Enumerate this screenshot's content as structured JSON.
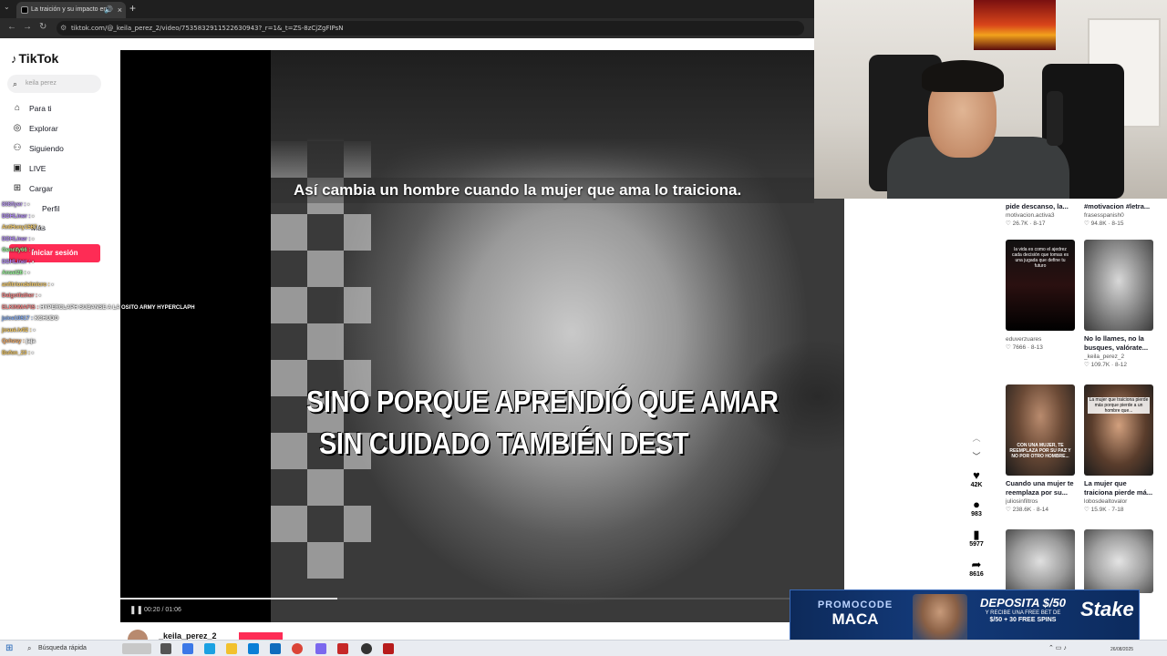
{
  "browser": {
    "tab_title": "La traición y su impacto en",
    "new_tab": "+",
    "url": "tiktok.com/@_keila_perez_2/video/7535832911522630943?_r=1&_t=ZS-8zCjZgFIPsN"
  },
  "sidebar": {
    "logo": "TikTok",
    "search_placeholder": "keila perez",
    "items": [
      {
        "label": "Para ti",
        "icon": "home-icon"
      },
      {
        "label": "Explorar",
        "icon": "compass-icon"
      },
      {
        "label": "Siguiendo",
        "icon": "following-icon"
      },
      {
        "label": "LIVE",
        "icon": "live-icon"
      },
      {
        "label": "Cargar",
        "icon": "upload-icon"
      },
      {
        "label": "Perfil",
        "icon": "profile-icon"
      },
      {
        "label": "Más",
        "icon": "more-icon"
      }
    ],
    "login": "Iniciar sesión"
  },
  "chat": [
    {
      "user": "808flyer",
      "msg": "",
      "color": "#c6a6ff"
    },
    {
      "user": "DDHLiner",
      "msg": "",
      "color": "#b890ff"
    },
    {
      "user": "AntHony1567",
      "msg": "",
      "color": "#ffd36a"
    },
    {
      "user": "DDHLiner",
      "msg": "",
      "color": "#b890ff"
    },
    {
      "user": "Genrify66",
      "msg": "",
      "color": "#9cff9c"
    },
    {
      "user": "DDHLiner",
      "msg": "",
      "color": "#b890ff"
    },
    {
      "user": "Ansel26",
      "msg": "",
      "color": "#9cff9c"
    },
    {
      "user": "anfitriondelmicro",
      "msg": "",
      "color": "#ffd36a"
    },
    {
      "user": "Dalgotfather",
      "msg": "",
      "color": "#ff8a8a"
    },
    {
      "user": "ELKINMAFIS",
      "msg": "HYPERCLAPH SUBANSE A LA OSITO ARMY HYPERCLAPH",
      "color": "#ff8a8a"
    },
    {
      "user": "juice10617",
      "msg": "KCHUDO",
      "color": "#8ab4ff"
    },
    {
      "user": "josué.lv92",
      "msg": "",
      "color": "#ffd36a"
    },
    {
      "user": "Qchzsy",
      "msg": "jaja",
      "color": "#ffb36a"
    },
    {
      "user": "Bufon_23",
      "msg": "",
      "color": "#ffd36a"
    }
  ],
  "video": {
    "subtitle_top": "Así cambia un hombre cuando la mujer que ama lo traiciona.",
    "subtitle_line1": "SINO PORQUE APRENDIÓ QUE AMAR",
    "subtitle_line2": "SIN CUIDADO TAMBIÉN DEST",
    "time": "00:20 / 01:06",
    "progress": 0.3,
    "play_icon": "pause-icon"
  },
  "actions": {
    "likes": "42K",
    "comments": "983",
    "saves": "5977",
    "shares": "8616"
  },
  "recommendations": [
    {
      "title": "pide descanso, la...",
      "user": "motivacion.activa3",
      "views": "26.7K",
      "date": "8-17"
    },
    {
      "title": "#motivacion #letra...",
      "user": "frasesspanish0",
      "views": "94.8K",
      "date": "8-15"
    },
    {
      "title": "",
      "user": "eduverzuares",
      "views": "7666",
      "date": "8-13",
      "thumb_text": "la vida es como el ajedrez cada decisión que tomas es una jugada que define tu futuro"
    },
    {
      "title": "No lo llames, no la busques, valórate...",
      "user": "_keila_perez_2",
      "views": "109.7K",
      "date": "8-12"
    },
    {
      "title": "Cuando una mujer te reemplaza por su...",
      "user": "juliosinfiltros",
      "views": "238.6K",
      "date": "8-14",
      "thumb_text": "CON UNA MUJER, TE REEMPLAZA POR SU PAZ Y NO POR OTRO HOMBRE..."
    },
    {
      "title": "La mujer que traiciona pierde má...",
      "user": "lobosdealtovalor",
      "views": "15.9K",
      "date": "7-18",
      "thumb_text": "La mujer que traiciona pierde más porque pierde a un hombre que..."
    }
  ],
  "below_video": {
    "username": "_keila_perez_2"
  },
  "ad": {
    "promo_label": "PROMOCODE",
    "promo_code": "MACA",
    "deposit": "DEPOSITA $/50",
    "deposit_sub": "Y RECIBE UNA FREE BET DE",
    "deposit_bonus": "$/50 + 30 FREE SPINS",
    "brand": "Stake"
  },
  "taskbar": {
    "search": "Búsqueda rápida",
    "date": "26/08/2025"
  },
  "colors": {
    "accent": "#fe2c55",
    "ad_bg": "#133a7a"
  }
}
